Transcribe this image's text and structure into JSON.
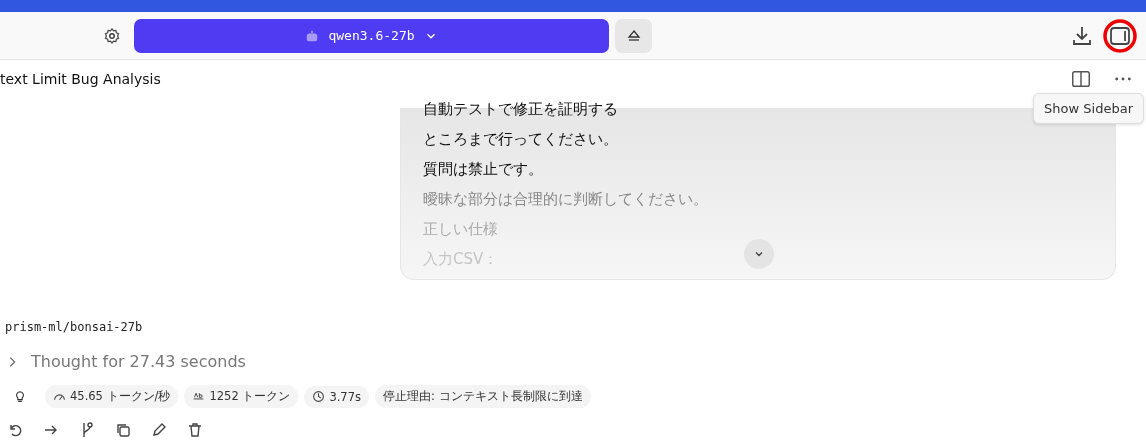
{
  "toolbar": {
    "model": "qwen3.6-27b"
  },
  "chat": {
    "title": "text Limit Bug Analysis",
    "tooltip": "Show Sidebar"
  },
  "message": {
    "lines": [
      {
        "text": "自動テストで修正を証明する",
        "faded": false
      },
      {
        "text": "ところまで行ってください。",
        "faded": false
      },
      {
        "text": "質問は禁止です。",
        "faded": false
      },
      {
        "text": "曖昧な部分は合理的に判断してください。",
        "faded": true
      },
      {
        "text": "正しい仕様",
        "faded": true
      },
      {
        "text": "入力CSV：",
        "faded": true
      }
    ]
  },
  "response": {
    "model": "prism-ml/bonsai-27b",
    "thought": "Thought for 27.43 seconds",
    "expanded": false,
    "stats": [
      {
        "kind": "speed",
        "text": "45.65 トークン/秒"
      },
      {
        "kind": "tokens",
        "text": "1252 トークン"
      },
      {
        "kind": "time",
        "text": "3.77s"
      },
      {
        "kind": "plain",
        "text": "停止理由: コンテキスト長制限に到達"
      }
    ]
  }
}
